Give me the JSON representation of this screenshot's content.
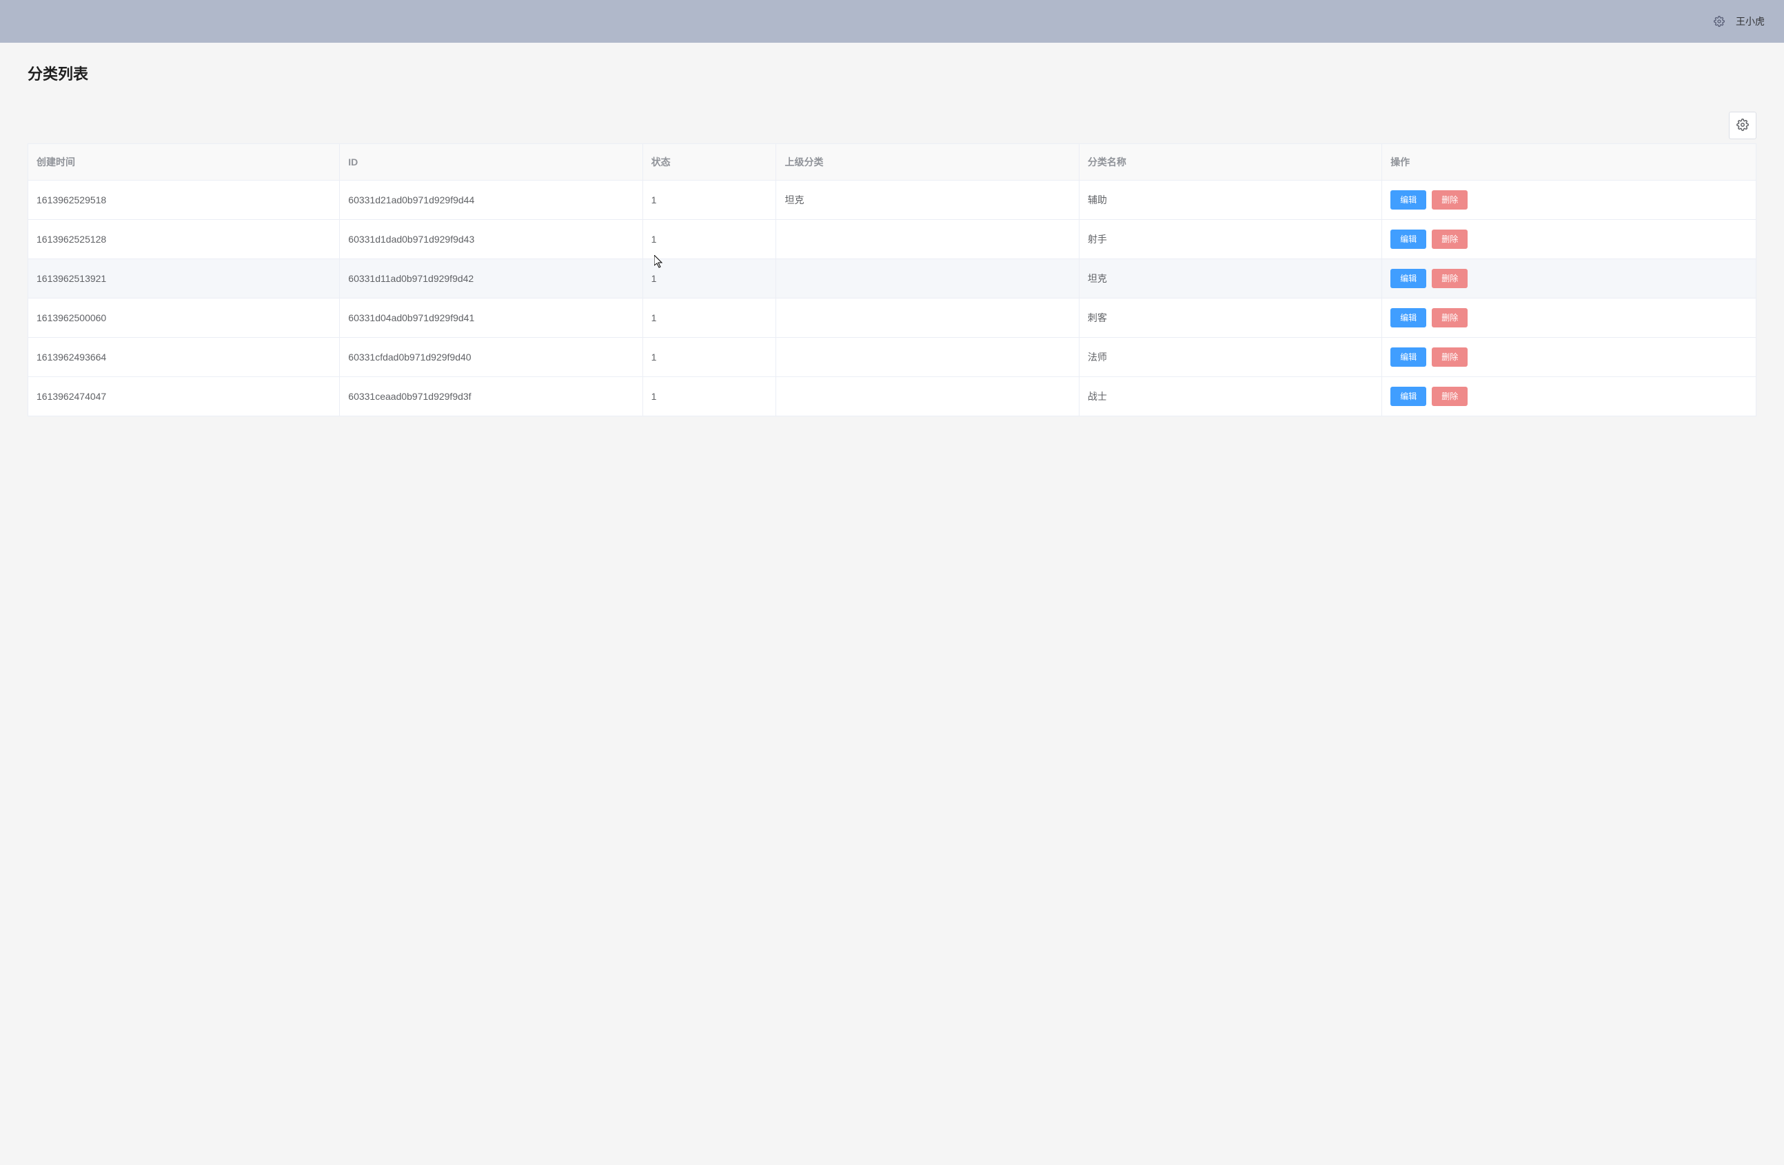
{
  "header": {
    "username": "王小虎"
  },
  "page": {
    "title": "分类列表"
  },
  "table": {
    "columns": {
      "created": "创建时间",
      "id": "ID",
      "status": "状态",
      "parent": "上级分类",
      "name": "分类名称",
      "ops": "操作"
    },
    "actions": {
      "edit": "编辑",
      "delete": "删除"
    },
    "rows": [
      {
        "created": "1613962529518",
        "id": "60331d21ad0b971d929f9d44",
        "status": "1",
        "parent": "坦克",
        "name": "辅助"
      },
      {
        "created": "1613962525128",
        "id": "60331d1dad0b971d929f9d43",
        "status": "1",
        "parent": "",
        "name": "射手"
      },
      {
        "created": "1613962513921",
        "id": "60331d11ad0b971d929f9d42",
        "status": "1",
        "parent": "",
        "name": "坦克"
      },
      {
        "created": "1613962500060",
        "id": "60331d04ad0b971d929f9d41",
        "status": "1",
        "parent": "",
        "name": "刺客"
      },
      {
        "created": "1613962493664",
        "id": "60331cfdad0b971d929f9d40",
        "status": "1",
        "parent": "",
        "name": "法师"
      },
      {
        "created": "1613962474047",
        "id": "60331ceaad0b971d929f9d3f",
        "status": "1",
        "parent": "",
        "name": "战士"
      }
    ],
    "hovered_row_index": 2
  }
}
